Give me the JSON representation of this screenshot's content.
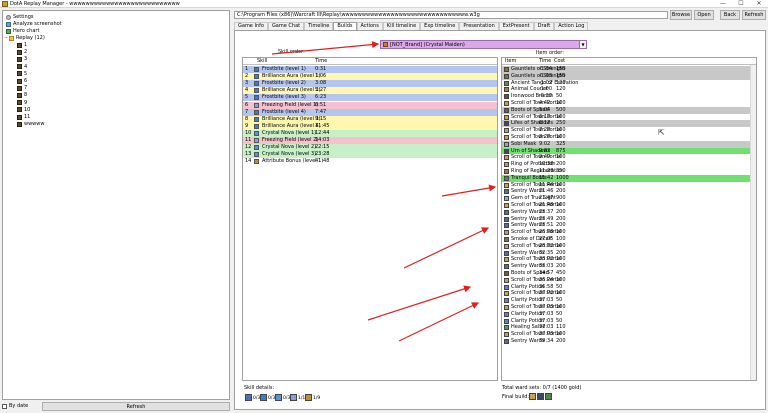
{
  "window": {
    "title": "DotA Replay Manager - wwwwwwwwwwwwwwwwwwwwwwwwwww",
    "controls": [
      "—",
      "☐",
      "✕"
    ]
  },
  "tree": {
    "items": [
      {
        "label": "Settings",
        "icon": "gear-icon"
      },
      {
        "label": "Analyze screenshot",
        "icon": "camera-icon"
      },
      {
        "label": "Hero chart",
        "icon": "chart-icon"
      },
      {
        "label": "Replay (12)",
        "icon": "folder-icon",
        "expander": "−"
      },
      {
        "label": "1"
      },
      {
        "label": "2"
      },
      {
        "label": "3"
      },
      {
        "label": "4"
      },
      {
        "label": "5"
      },
      {
        "label": "6"
      },
      {
        "label": "7"
      },
      {
        "label": "8"
      },
      {
        "label": "9"
      },
      {
        "label": "10"
      },
      {
        "label": "11"
      },
      {
        "label": "wwwww"
      }
    ]
  },
  "bottom_left": {
    "by_date_label": "By date",
    "refresh_label": "Refresh"
  },
  "path": {
    "value": "C:\\Program Files (x86)\\Warcraft III\\Replay\\wwwwwwwwwwwwwwwwwwwwwwwwwwwwwww.w3g",
    "browse_label": "Browse",
    "open_label": "Open",
    "back_label": "Back",
    "refresh_label": "Refresh"
  },
  "tabs": [
    "Game Info",
    "Game Chat",
    "Timeline",
    "Builds",
    "Actions",
    "Kill timeline",
    "Exp timeline",
    "Presentation",
    "ExtPresent",
    "Draft",
    "Action Log"
  ],
  "active_tab": "Builds",
  "builds": {
    "skill_order_label": "Skill order:",
    "item_order_label": "Item order:",
    "hero_selected": "[NOT_Brand] (Crystal Maiden)",
    "skill_headers": {
      "skill": "Skill",
      "time": "Time"
    },
    "skills": [
      {
        "n": "1",
        "skill": "Frostbite (level 1)",
        "time": "0:31",
        "color": "#b4c6f0",
        "icon": "#4a70c8"
      },
      {
        "n": "2",
        "skill": "Brilliance Aura (level 1)",
        "time": "1:06",
        "color": "#fff6b0",
        "icon": "#3a80d0"
      },
      {
        "n": "3",
        "skill": "Frostbite (level 2)",
        "time": "3:08",
        "color": "#b4c6f0",
        "icon": "#4a70c8"
      },
      {
        "n": "4",
        "skill": "Brilliance Aura (level 2)",
        "time": "5:27",
        "color": "#fff6b0",
        "icon": "#3a80d0"
      },
      {
        "n": "5",
        "skill": "Frostbite (level 3)",
        "time": "6:23",
        "color": "#b4c6f0",
        "icon": "#4a70c8"
      },
      {
        "n": "6",
        "skill": "Freezing Field (level 1)",
        "time": "6:51",
        "color": "#f6c0cc",
        "icon": "#8aa0d8"
      },
      {
        "n": "7",
        "skill": "Frostbite (level 4)",
        "time": "7:47",
        "color": "#b4c6f0",
        "icon": "#4a70c8"
      },
      {
        "n": "8",
        "skill": "Brilliance Aura (level 3)",
        "time": "9:15",
        "color": "#fff6b0",
        "icon": "#3a80d0"
      },
      {
        "n": "9",
        "skill": "Brilliance Aura (level 4)",
        "time": "11:45",
        "color": "#fff6b0",
        "icon": "#3a80d0"
      },
      {
        "n": "10",
        "skill": "Crystal Nova (level 1)",
        "time": "12:44",
        "color": "#c6f0c6",
        "icon": "#5a90e0"
      },
      {
        "n": "11",
        "skill": "Freezing Field (level 2)",
        "time": "14:03",
        "color": "#f6c0cc",
        "icon": "#8aa0d8"
      },
      {
        "n": "12",
        "skill": "Crystal Nova (level 2)",
        "time": "22:15",
        "color": "#c6f0c6",
        "icon": "#5a90e0"
      },
      {
        "n": "13",
        "skill": "Crystal Nova (level 3)",
        "time": "23:28",
        "color": "#c6f0c6",
        "icon": "#5a90e0"
      },
      {
        "n": "14",
        "skill": "Attribute Bonus (level 1)",
        "time": "41:48",
        "color": "#ffffff",
        "icon": "#c09030"
      }
    ],
    "item_headers": {
      "item": "Item",
      "time": "Time",
      "cost": "Cost"
    },
    "items": [
      {
        "item": "Gauntlets of Strength",
        "time": "-1:04",
        "cost": "150",
        "color": "#c8c8c8",
        "icon": "#8a6a40"
      },
      {
        "item": "Gauntlets of Strength",
        "time": "-1:03",
        "cost": "150",
        "color": "#c8c8c8",
        "icon": "#8a6a40"
      },
      {
        "item": "Ancient Tango of Essifation",
        "time": "-1:02",
        "cost": "120",
        "color": "#ffffff",
        "icon": "#6a8a40"
      },
      {
        "item": "Animal Courier",
        "time": "-1:00",
        "cost": "120",
        "color": "#ffffff",
        "icon": "#a08050"
      },
      {
        "item": "Ironwood Branch",
        "time": "-0:30",
        "cost": "50",
        "color": "#ffffff",
        "icon": "#6a5030"
      },
      {
        "item": "Scroll of Town Portal",
        "time": "4:42",
        "cost": "100",
        "color": "#ffffff",
        "icon": "#c8a050"
      },
      {
        "item": "Boots of Speed",
        "time": "5:04",
        "cost": "500",
        "color": "#c8c8c8",
        "icon": "#7a5a30"
      },
      {
        "item": "Scroll of Town Portal",
        "time": "6:13",
        "cost": "100",
        "color": "#ffffff",
        "icon": "#c8a050"
      },
      {
        "item": "Lifes of Shadows",
        "time": "6:17",
        "cost": "250",
        "color": "#c8c8c8",
        "icon": "#404860"
      },
      {
        "item": "Scroll of Town Portal",
        "time": "7:28",
        "cost": "100",
        "color": "#ffffff",
        "icon": "#c8a050"
      },
      {
        "item": "Scroll of Town Portal",
        "time": "8:28",
        "cost": "100",
        "color": "#ffffff",
        "icon": "#c8a050"
      },
      {
        "item": "Sobi Mask",
        "time": "9:02",
        "cost": "325",
        "color": "#c8c8c8",
        "icon": "#a0a0b0"
      },
      {
        "item": "Urn of Shadows",
        "time": "9:02",
        "cost": "875",
        "color": "#70e070",
        "icon": "#404860"
      },
      {
        "item": "Scroll of Town Portal",
        "time": "9:49",
        "cost": "100",
        "color": "#ffffff",
        "icon": "#c8a050"
      },
      {
        "item": "Ring of Protection",
        "time": "10:38",
        "cost": "200",
        "color": "#ffffff",
        "icon": "#b0a070"
      },
      {
        "item": "Ring of Regeneration",
        "time": "11:28",
        "cost": "350",
        "color": "#ffffff",
        "icon": "#b07030"
      },
      {
        "item": "Tranquil Boots",
        "time": "11:42",
        "cost": "1000",
        "color": "#70e070",
        "icon": "#508a40"
      },
      {
        "item": "Scroll of Town Portal",
        "time": "11:44",
        "cost": "100",
        "color": "#ffffff",
        "icon": "#c8a050"
      },
      {
        "item": "Sentry Wards",
        "time": "21:46",
        "cost": "200",
        "color": "#ffffff",
        "icon": "#5070a0"
      },
      {
        "item": "Gem of True Sight",
        "time": "21:47",
        "cost": "900",
        "color": "#ffffff",
        "icon": "#60c0d0"
      },
      {
        "item": "Scroll of Town Portal",
        "time": "21:48",
        "cost": "100",
        "color": "#ffffff",
        "icon": "#c8a050"
      },
      {
        "item": "Sentry Wards",
        "time": "23:37",
        "cost": "200",
        "color": "#ffffff",
        "icon": "#5070a0"
      },
      {
        "item": "Sentry Wards",
        "time": "23:49",
        "cost": "200",
        "color": "#ffffff",
        "icon": "#5070a0"
      },
      {
        "item": "Sentry Wards",
        "time": "23:51",
        "cost": "200",
        "color": "#ffffff",
        "icon": "#5070a0"
      },
      {
        "item": "Scroll of Town Portal",
        "time": "26:58",
        "cost": "100",
        "color": "#ffffff",
        "icon": "#c8a050"
      },
      {
        "item": "Smoke of Deceit",
        "time": "27:05",
        "cost": "100",
        "color": "#ffffff",
        "icon": "#707070"
      },
      {
        "item": "Scroll of Town Portal",
        "time": "28:32",
        "cost": "100",
        "color": "#ffffff",
        "icon": "#c8a050"
      },
      {
        "item": "Sentry Wards",
        "time": "32:35",
        "cost": "200",
        "color": "#ffffff",
        "icon": "#5070a0"
      },
      {
        "item": "Scroll of Town Portal",
        "time": "33:02",
        "cost": "100",
        "color": "#ffffff",
        "icon": "#c8a050"
      },
      {
        "item": "Sentry Wards",
        "time": "33:03",
        "cost": "200",
        "color": "#ffffff",
        "icon": "#5070a0"
      },
      {
        "item": "Boots of Speed",
        "time": "34:57",
        "cost": "450",
        "color": "#ffffff",
        "icon": "#7a5a30"
      },
      {
        "item": "Scroll of Town Portal",
        "time": "36:24",
        "cost": "100",
        "color": "#ffffff",
        "icon": "#c8a050"
      },
      {
        "item": "Clarity Potion",
        "time": "36:58",
        "cost": "50",
        "color": "#ffffff",
        "icon": "#6080d0"
      },
      {
        "item": "Scroll of Town Portal",
        "time": "37:02",
        "cost": "100",
        "color": "#ffffff",
        "icon": "#c8a050"
      },
      {
        "item": "Clarity Potion",
        "time": "37:03",
        "cost": "50",
        "color": "#ffffff",
        "icon": "#6080d0"
      },
      {
        "item": "Scroll of Town Portal",
        "time": "37:03",
        "cost": "100",
        "color": "#ffffff",
        "icon": "#c8a050"
      },
      {
        "item": "Clarity Potion",
        "time": "37:03",
        "cost": "50",
        "color": "#ffffff",
        "icon": "#6080d0"
      },
      {
        "item": "Clarity Potion",
        "time": "37:03",
        "cost": "50",
        "color": "#ffffff",
        "icon": "#6080d0"
      },
      {
        "item": "Healing Salve",
        "time": "37:03",
        "cost": "110",
        "color": "#ffffff",
        "icon": "#50a050"
      },
      {
        "item": "Scroll of Town Portal",
        "time": "37:03",
        "cost": "100",
        "color": "#ffffff",
        "icon": "#c8a050"
      },
      {
        "item": "Sentry Wards",
        "time": "39:34",
        "cost": "200",
        "color": "#ffffff",
        "icon": "#5070a0"
      }
    ],
    "skill_details_label": "Skill details:",
    "skill_counts": [
      {
        "value": "0/3",
        "icon": "#4a70c8"
      },
      {
        "value": "0/3",
        "icon": "#3a80d0"
      },
      {
        "value": "0/3",
        "icon": "#5a90e0"
      },
      {
        "value": "1/1",
        "icon": "#8aa0d8"
      },
      {
        "value": "1/9",
        "icon": "#c09030"
      }
    ],
    "ward_summary": "Total ward sets: 0/7 (1400 gold)",
    "final_build_label": "Final build:",
    "final_build_icons": [
      "#c8a050",
      "#404860",
      "#508a40"
    ]
  },
  "colors": {
    "annotation_arrow": "#e02020"
  }
}
